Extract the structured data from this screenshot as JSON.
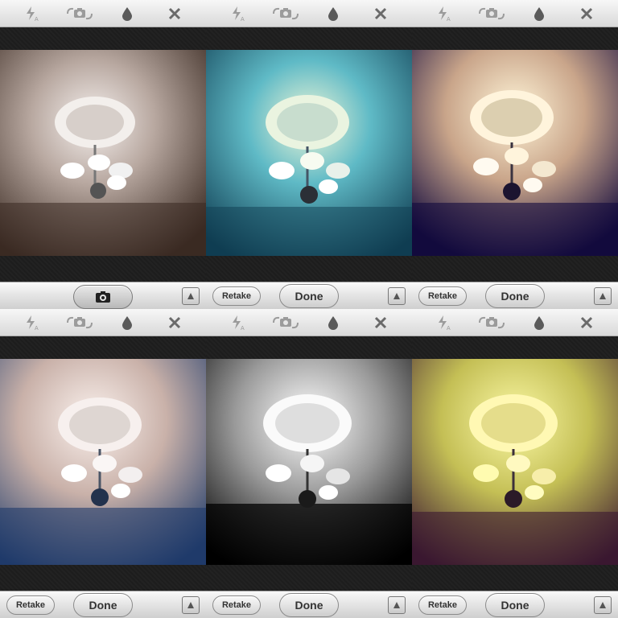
{
  "panels": [
    {
      "filter_color": "#8a7a6a",
      "tint": "#3a2a22",
      "has_retake": false,
      "primary": "shutter"
    },
    {
      "filter_color": "#2f8fa0",
      "tint": "#0f3d52",
      "has_retake": true,
      "primary": "done"
    },
    {
      "filter_color": "#d8b07a",
      "tint": "#120a3d",
      "has_retake": true,
      "primary": "done"
    },
    {
      "filter_color": "#c7a89c",
      "tint": "#1f3b6a",
      "has_retake": true,
      "primary": "done"
    },
    {
      "filter_color": "#d9d9d9",
      "tint": "#000000",
      "has_retake": true,
      "primary": "done"
    },
    {
      "filter_color": "#d8dc55",
      "tint": "#3a1830",
      "has_retake": true,
      "primary": "done"
    }
  ],
  "labels": {
    "retake": "Retake",
    "done": "Done"
  },
  "icons": {
    "flash": "flash-auto-icon",
    "flip": "camera-flip-icon",
    "drop": "water-drop-icon",
    "close": "close-icon",
    "shutter": "camera-icon",
    "expand": "triangle-up-icon"
  }
}
